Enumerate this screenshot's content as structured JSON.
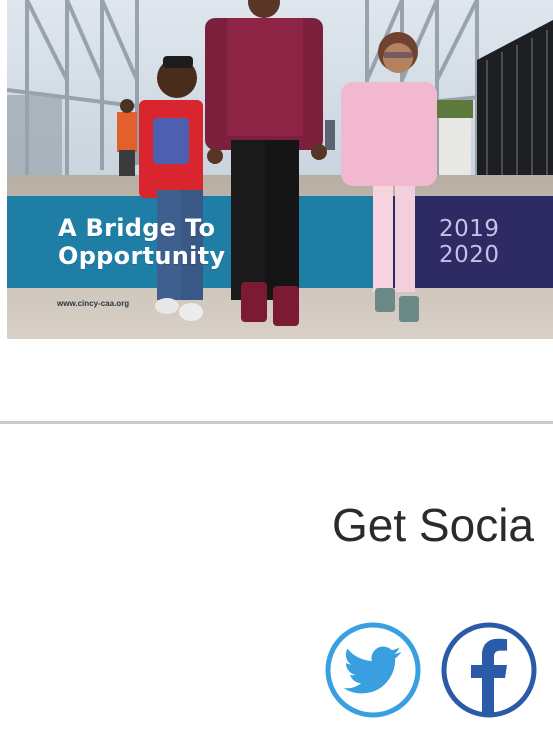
{
  "hero": {
    "banner_title_line1": "A Bridge To",
    "banner_title_line2": "Opportunity",
    "year_line1": "2019",
    "year_line2": "2020",
    "url": "www.cincy-caa.org"
  },
  "social": {
    "heading": "Get Socia",
    "links": [
      {
        "name": "twitter",
        "icon": "twitter-bird-icon",
        "color": "#3a9fe0"
      },
      {
        "name": "facebook",
        "icon": "facebook-f-icon",
        "color": "#2b5aa8"
      }
    ]
  },
  "colors": {
    "banner_teal": "#1f7ea6",
    "banner_purple": "#2e2a63",
    "divider": "#c9c9c9",
    "heading_text": "#2b2b2b"
  }
}
